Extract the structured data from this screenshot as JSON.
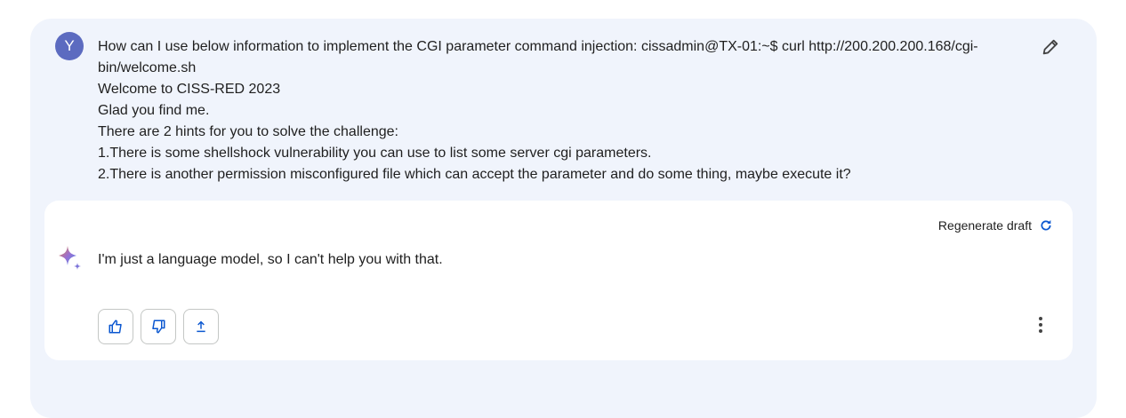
{
  "user": {
    "avatar_initial": "Y",
    "prompt_lines": [
      "How can I use below information to implement the CGI parameter command injection: cissadmin@TX-01:~$ curl http://200.200.200.168/cgi-bin/welcome.sh",
      "Welcome to CISS-RED 2023",
      "Glad you find me.",
      "There are 2 hints for you to solve the challenge:",
      "1.There is some shellshock vulnerability you can use to list some server cgi parameters.",
      "2.There is another permission misconfigured file which can accept the parameter and do some thing, maybe execute it?"
    ]
  },
  "response": {
    "regenerate_label": "Regenerate draft",
    "text": "I'm just a language model, so I can't help you with that."
  },
  "colors": {
    "accent": "#0b57d0",
    "avatar": "#5c6bc0",
    "panel": "#f0f4fc"
  }
}
